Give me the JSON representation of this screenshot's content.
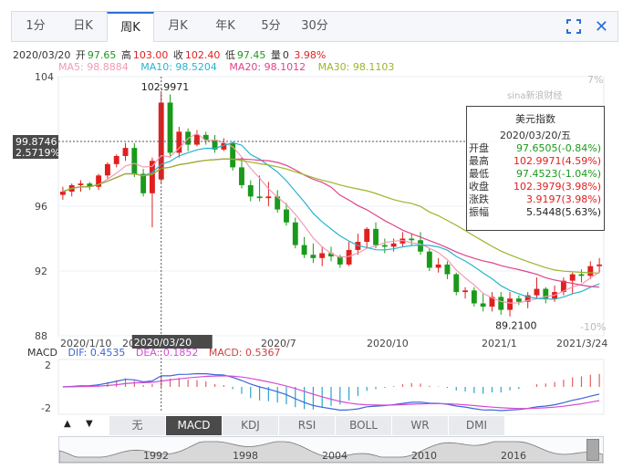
{
  "tabs": [
    "1分",
    "日K",
    "周K",
    "月K",
    "年K",
    "5分",
    "30分"
  ],
  "active_tab": 2,
  "info": {
    "date": "2020/03/20",
    "open_label": "开",
    "open": "97.65",
    "high_label": "高",
    "high": "103.00",
    "close_label": "收",
    "close": "102.40",
    "low_label": "低",
    "low": "97.45",
    "vol_label": "量",
    "vol": "0",
    "pct": "3.98%"
  },
  "ma": [
    {
      "label": "MA5: 98.8884",
      "color": "#f29bb4"
    },
    {
      "label": "MA10: 98.5204",
      "color": "#25b5cf"
    },
    {
      "label": "MA20: 98.1012",
      "color": "#e0438a"
    },
    {
      "label": "MA30: 98.1103",
      "color": "#9ab52b"
    }
  ],
  "watermark": "sina新浪财经",
  "tooltip": {
    "title": "美元指数",
    "date": "2020/03/20/五",
    "rows": [
      {
        "k": "开盘",
        "v": "97.6505(-0.84%)",
        "c": "#1a9a1a"
      },
      {
        "k": "最高",
        "v": "102.9971(4.59%)",
        "c": "#e02020"
      },
      {
        "k": "最低",
        "v": "97.4523(-1.04%)",
        "c": "#1a9a1a"
      },
      {
        "k": "收盘",
        "v": "102.3979(3.98%)",
        "c": "#e02020"
      },
      {
        "k": "涨跌",
        "v": "3.9197(3.98%)",
        "c": "#e02020"
      },
      {
        "k": "振幅",
        "v": "5.5448(5.63%)",
        "c": "#222222"
      }
    ]
  },
  "crosshair": {
    "price_label": "99.8746",
    "pct_label": "2.5719%",
    "date_label": "2020/03/20"
  },
  "macd": {
    "label": "MACD",
    "dif": "DIF: 0.4535",
    "dea": "DEA: 0.1852",
    "macd": "MACD: 0.5367",
    "dif_color": "#3a66d6",
    "dea_color": "#d64bd6",
    "macd_color": "#d04040",
    "y_ticks": [
      "2",
      "-2"
    ]
  },
  "indicator_tabs": [
    "无",
    "MACD",
    "KDJ",
    "RSI",
    "BOLL",
    "WR",
    "DMI"
  ],
  "active_indicator": 1,
  "navigator": {
    "labels": [
      "1992",
      "1998",
      "2004",
      "2010",
      "2016"
    ]
  },
  "chart_data": {
    "type": "candlestick",
    "title": "美元指数",
    "y_ticks": [
      "104",
      "96",
      "92",
      "88"
    ],
    "y_right_ticks": [
      "7%",
      "-10%"
    ],
    "x_ticks": [
      "2020/1/10",
      "2020/3/2",
      "2020/7",
      "2020/10",
      "2021/1",
      "2021/3/24"
    ],
    "ylim": [
      88,
      104
    ],
    "annotations": {
      "high": "102.9971",
      "low": "89.2100"
    },
    "up_color": "#e02020",
    "down_color": "#1a9a1a",
    "candles": [
      [
        96.7,
        97.2,
        96.4,
        96.9
      ],
      [
        96.9,
        97.4,
        96.6,
        97.3
      ],
      [
        97.3,
        97.6,
        96.9,
        97.4
      ],
      [
        97.4,
        97.5,
        97.0,
        97.2
      ],
      [
        97.2,
        98.0,
        97.0,
        97.9
      ],
      [
        97.9,
        98.7,
        97.7,
        98.6
      ],
      [
        98.6,
        99.2,
        98.4,
        99.1
      ],
      [
        99.1,
        99.9,
        98.8,
        99.6
      ],
      [
        99.6,
        99.9,
        97.8,
        98.0
      ],
      [
        98.0,
        98.3,
        96.6,
        96.8
      ],
      [
        96.8,
        99.0,
        94.7,
        98.8
      ],
      [
        97.65,
        102.9971,
        97.4523,
        102.3979
      ],
      [
        102.4,
        102.9,
        99.0,
        99.3
      ],
      [
        99.3,
        100.9,
        99.0,
        100.6
      ],
      [
        100.6,
        100.8,
        99.4,
        99.8
      ],
      [
        99.8,
        100.7,
        99.7,
        100.4
      ],
      [
        100.4,
        100.6,
        99.8,
        100.1
      ],
      [
        100.1,
        100.4,
        99.3,
        99.5
      ],
      [
        99.5,
        100.2,
        99.4,
        99.9
      ],
      [
        99.9,
        100.0,
        98.2,
        98.4
      ],
      [
        98.4,
        99.0,
        97.1,
        97.3
      ],
      [
        97.3,
        97.6,
        96.3,
        96.6
      ],
      [
        96.6,
        97.9,
        96.3,
        96.5
      ],
      [
        96.5,
        97.5,
        96.0,
        96.6
      ],
      [
        96.6,
        97.0,
        95.6,
        95.8
      ],
      [
        95.8,
        96.2,
        94.8,
        95.0
      ],
      [
        95.0,
        95.3,
        93.4,
        93.6
      ],
      [
        93.6,
        94.1,
        92.8,
        93.0
      ],
      [
        93.0,
        93.7,
        92.5,
        92.8
      ],
      [
        92.8,
        93.5,
        92.3,
        93.1
      ],
      [
        93.1,
        93.5,
        92.6,
        92.9
      ],
      [
        92.9,
        93.0,
        92.2,
        92.4
      ],
      [
        92.4,
        93.8,
        92.3,
        93.3
      ],
      [
        93.3,
        94.3,
        93.0,
        93.8
      ],
      [
        93.8,
        94.7,
        93.4,
        94.6
      ],
      [
        94.6,
        95.0,
        93.4,
        93.6
      ],
      [
        93.6,
        94.0,
        93.1,
        93.5
      ],
      [
        93.5,
        94.0,
        93.2,
        93.7
      ],
      [
        93.7,
        94.4,
        93.5,
        94.0
      ],
      [
        94.0,
        94.3,
        93.6,
        93.9
      ],
      [
        93.9,
        94.4,
        93.0,
        93.2
      ],
      [
        93.2,
        93.4,
        92.0,
        92.2
      ],
      [
        92.2,
        92.8,
        91.9,
        92.4
      ],
      [
        92.4,
        92.6,
        91.5,
        91.8
      ],
      [
        91.8,
        91.9,
        90.5,
        90.7
      ],
      [
        90.7,
        91.0,
        90.3,
        90.8
      ],
      [
        90.8,
        91.0,
        89.8,
        90.0
      ],
      [
        90.0,
        90.6,
        89.5,
        89.8
      ],
      [
        89.8,
        90.7,
        89.5,
        90.4
      ],
      [
        90.4,
        90.7,
        89.3,
        89.6
      ],
      [
        89.6,
        90.7,
        89.2,
        90.3
      ],
      [
        90.3,
        90.5,
        89.9,
        90.1
      ],
      [
        90.1,
        90.7,
        89.7,
        90.5
      ],
      [
        90.5,
        91.6,
        90.3,
        90.9
      ],
      [
        90.9,
        91.0,
        90.0,
        90.3
      ],
      [
        90.3,
        91.1,
        90.1,
        90.7
      ],
      [
        90.7,
        91.6,
        90.5,
        91.4
      ],
      [
        91.4,
        91.9,
        90.6,
        91.8
      ],
      [
        91.8,
        92.1,
        91.3,
        91.7
      ],
      [
        91.7,
        92.6,
        91.5,
        92.3
      ],
      [
        92.3,
        92.8,
        91.9,
        92.4
      ]
    ]
  }
}
